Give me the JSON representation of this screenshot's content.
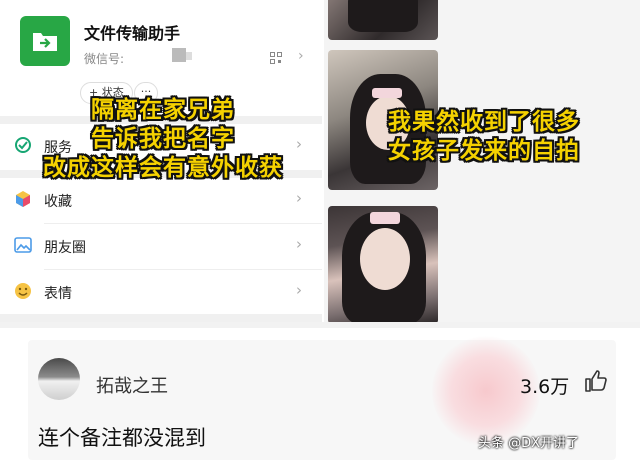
{
  "profile": {
    "name": "文件传输助手",
    "wechat_id_label": "微信号:",
    "status_label": "+ 状态",
    "more_label": "···"
  },
  "menu": {
    "items": [
      {
        "label": "服务",
        "icon": "service-icon"
      },
      {
        "label": "收藏",
        "icon": "favorites-icon"
      },
      {
        "label": "朋友圈",
        "icon": "moments-icon"
      },
      {
        "label": "表情",
        "icon": "sticker-icon"
      }
    ]
  },
  "captions": {
    "left_lines": [
      "隔离在家兄弟",
      "告诉我把名字",
      "改成这样会有意外收获"
    ],
    "right_lines": [
      "我果然收到了很多",
      "女孩子发来的自拍"
    ]
  },
  "comment": {
    "username": "拓哉之王",
    "like_count": "3.6万",
    "text": "连个备注都没混到"
  },
  "watermark": "头条 @DX开讲了",
  "colors": {
    "caption_yellow": "#f5d200",
    "wechat_green": "#28a745"
  }
}
